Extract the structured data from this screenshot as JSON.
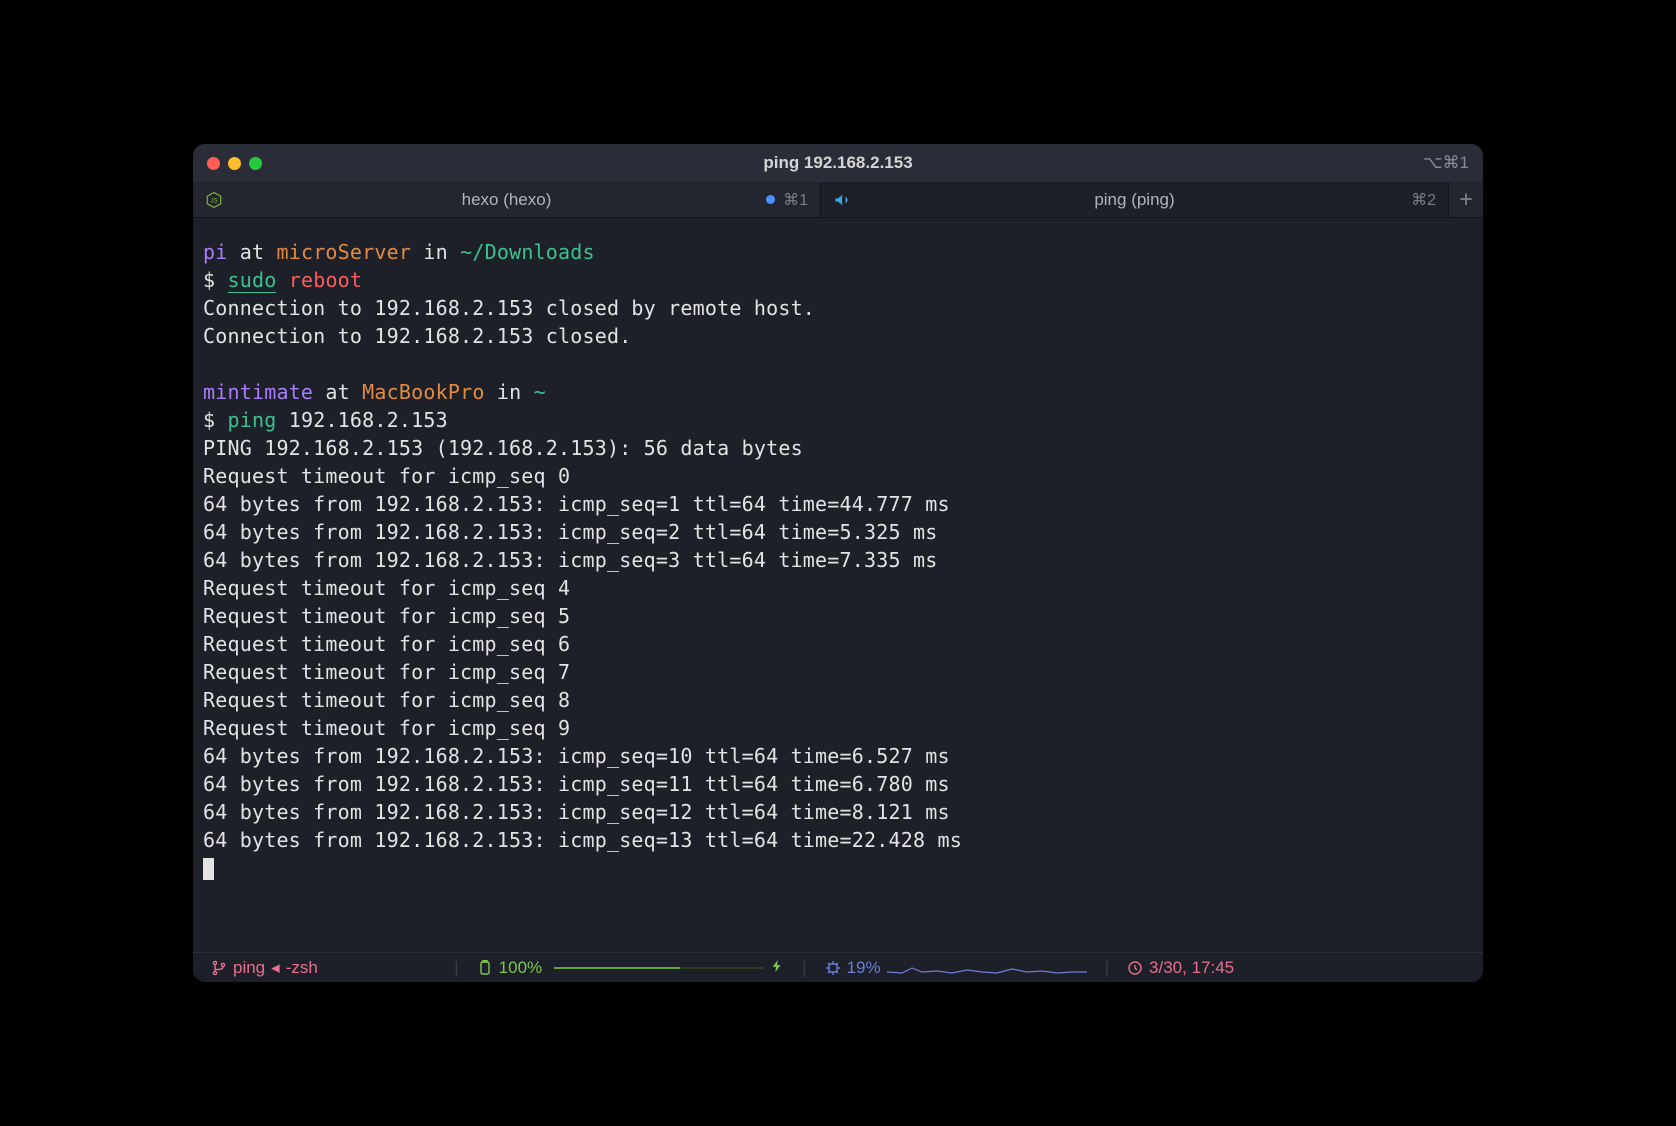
{
  "window": {
    "title": "ping 192.168.2.153",
    "right_shortcut": "⌥⌘1"
  },
  "tabs": [
    {
      "label": "hexo (hexo)",
      "shortcut": "⌘1"
    },
    {
      "label": "ping (ping)",
      "shortcut": "⌘2"
    }
  ],
  "session1": {
    "user": "pi",
    "at": "at",
    "host": "microServer",
    "in": "in",
    "path": "~/Downloads",
    "prompt": "$",
    "cmd_sudo": "sudo",
    "cmd_reboot": "reboot",
    "out1": "Connection to 192.168.2.153 closed by remote host.",
    "out2": "Connection to 192.168.2.153 closed."
  },
  "session2": {
    "user": "mintimate",
    "at": "at",
    "host": "MacBookPro",
    "in": "in",
    "path": "~",
    "prompt": "$",
    "cmd_ping": "ping",
    "cmd_arg": "192.168.2.153"
  },
  "ping_output": [
    "PING 192.168.2.153 (192.168.2.153): 56 data bytes",
    "Request timeout for icmp_seq 0",
    "64 bytes from 192.168.2.153: icmp_seq=1 ttl=64 time=44.777 ms",
    "64 bytes from 192.168.2.153: icmp_seq=2 ttl=64 time=5.325 ms",
    "64 bytes from 192.168.2.153: icmp_seq=3 ttl=64 time=7.335 ms",
    "Request timeout for icmp_seq 4",
    "Request timeout for icmp_seq 5",
    "Request timeout for icmp_seq 6",
    "Request timeout for icmp_seq 7",
    "Request timeout for icmp_seq 8",
    "Request timeout for icmp_seq 9",
    "64 bytes from 192.168.2.153: icmp_seq=10 ttl=64 time=6.527 ms",
    "64 bytes from 192.168.2.153: icmp_seq=11 ttl=64 time=6.780 ms",
    "64 bytes from 192.168.2.153: icmp_seq=12 ttl=64 time=8.121 ms",
    "64 bytes from 192.168.2.153: icmp_seq=13 ttl=64 time=22.428 ms"
  ],
  "statusbar": {
    "process": "ping",
    "caret": "◂",
    "shell": "-zsh",
    "battery": "100%",
    "bolt": "⚡︎",
    "cpu": "19%",
    "datetime": "3/30, 17:45"
  }
}
